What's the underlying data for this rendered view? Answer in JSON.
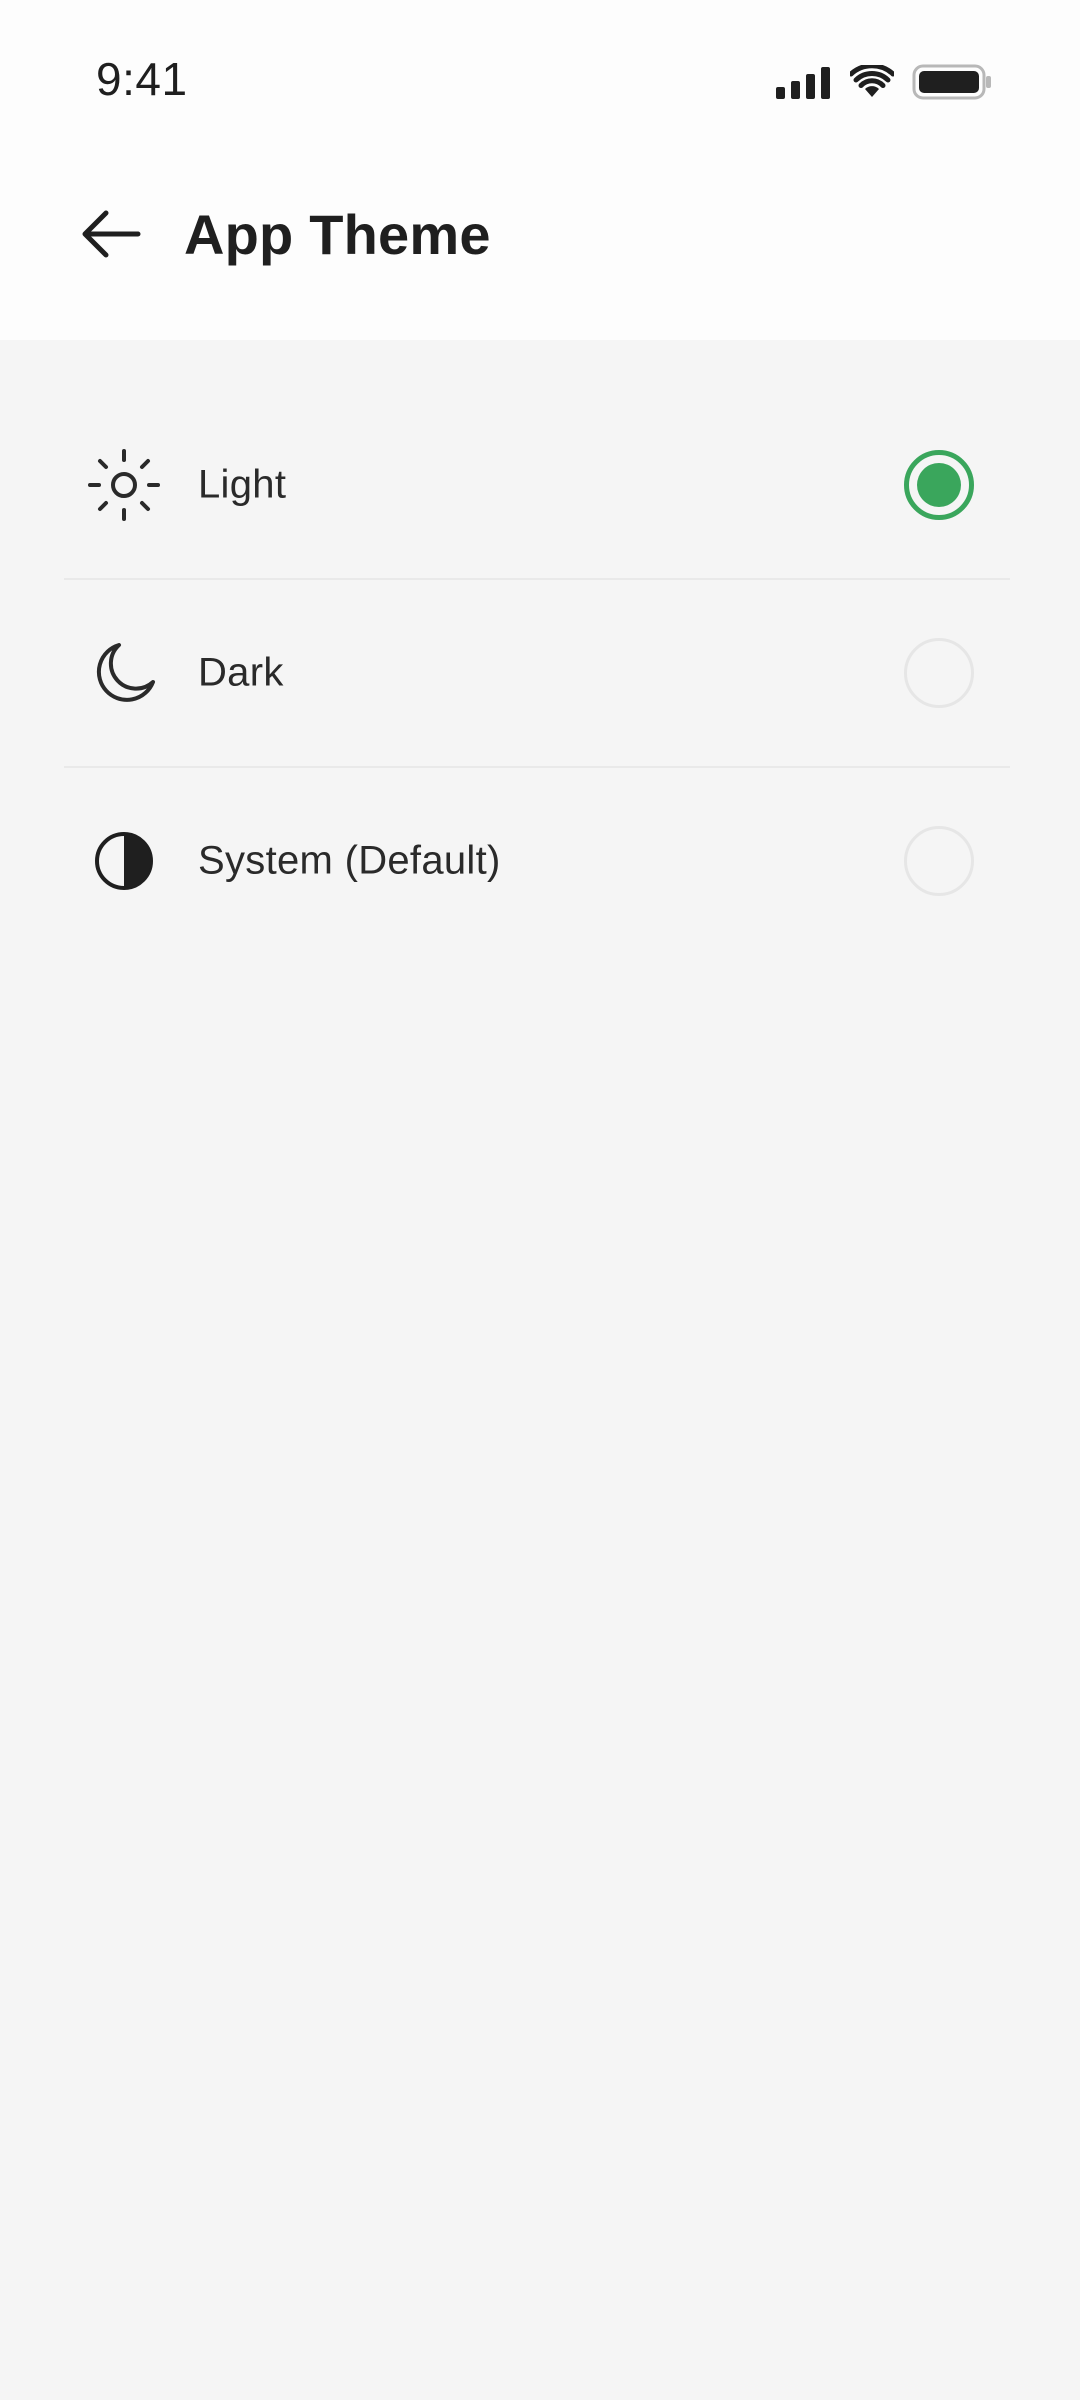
{
  "status_bar": {
    "time": "9:41",
    "icons": [
      "signal-icon",
      "wifi-icon",
      "battery-icon"
    ]
  },
  "header": {
    "back_icon": "arrow-left-icon",
    "title": "App Theme"
  },
  "options": [
    {
      "label": "Light",
      "icon": "sun-icon",
      "selected": true
    },
    {
      "label": "Dark",
      "icon": "moon-icon",
      "selected": false
    },
    {
      "label": "System (Default)",
      "icon": "contrast-icon",
      "selected": false
    }
  ],
  "colors": {
    "accent": "#3aa65c",
    "background": "#f5f5f5",
    "header_background": "#fdfdfd",
    "text": "#1f1f1f"
  }
}
